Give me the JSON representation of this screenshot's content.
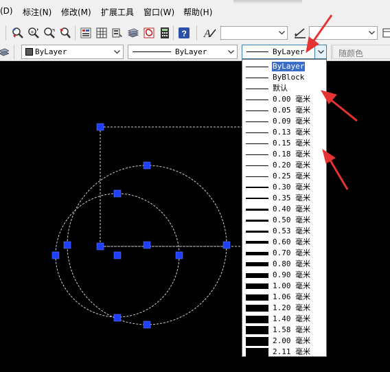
{
  "menu": {
    "items": [
      "(D)",
      "标注(N)",
      "修改(M)",
      "扩展工具",
      "窗口(W)",
      "帮助(H)"
    ]
  },
  "toolbar": {
    "text_style_value": "",
    "dim_style_value": "",
    "icons": [
      "draw-order-icon",
      "zoom-realtime-icon",
      "zoom-window-icon",
      "zoom-previous-icon",
      "properties-icon",
      "design-center-icon",
      "tool-palettes-icon",
      "sheet-set-icon",
      "markup-icon",
      "quickcalc-icon",
      "help-icon",
      "text-style-icon",
      "dim-style-icon"
    ]
  },
  "properties_bar": {
    "color_value": "ByLayer",
    "linetype_value": "ByLayer",
    "lineweight_value": "ByLayer",
    "plotstyle_value": "随颜色"
  },
  "lineweight_dropdown": {
    "selected_index": 0,
    "items": [
      {
        "label": "ByLayer",
        "weight": 1
      },
      {
        "label": "ByBlock",
        "weight": 1
      },
      {
        "label": "默认",
        "weight": 1
      },
      {
        "label": "0.00 毫米",
        "weight": 1
      },
      {
        "label": "0.05 毫米",
        "weight": 1
      },
      {
        "label": "0.09 毫米",
        "weight": 1
      },
      {
        "label": "0.13 毫米",
        "weight": 1
      },
      {
        "label": "0.15 毫米",
        "weight": 1
      },
      {
        "label": "0.18 毫米",
        "weight": 1
      },
      {
        "label": "0.20 毫米",
        "weight": 1
      },
      {
        "label": "0.25 毫米",
        "weight": 1
      },
      {
        "label": "0.30 毫米",
        "weight": 2
      },
      {
        "label": "0.35 毫米",
        "weight": 2
      },
      {
        "label": "0.40 毫米",
        "weight": 3
      },
      {
        "label": "0.50 毫米",
        "weight": 3
      },
      {
        "label": "0.53 毫米",
        "weight": 3
      },
      {
        "label": "0.60 毫米",
        "weight": 4
      },
      {
        "label": "0.70 毫米",
        "weight": 5
      },
      {
        "label": "0.80 毫米",
        "weight": 6
      },
      {
        "label": "0.90 毫米",
        "weight": 7
      },
      {
        "label": "1.00 毫米",
        "weight": 8
      },
      {
        "label": "1.06 毫米",
        "weight": 9
      },
      {
        "label": "1.20 毫米",
        "weight": 10
      },
      {
        "label": "1.40 毫米",
        "weight": 11
      },
      {
        "label": "1.58 毫米",
        "weight": 12
      },
      {
        "label": "2.00 毫米",
        "weight": 13
      },
      {
        "label": "2.11 毫米",
        "weight": 13
      }
    ]
  },
  "colors": {
    "grip": "#1f3fff",
    "annotation_arrow": "#e53333",
    "selection_highlight": "#3a6ec8",
    "canvas_bg": "#000000"
  }
}
